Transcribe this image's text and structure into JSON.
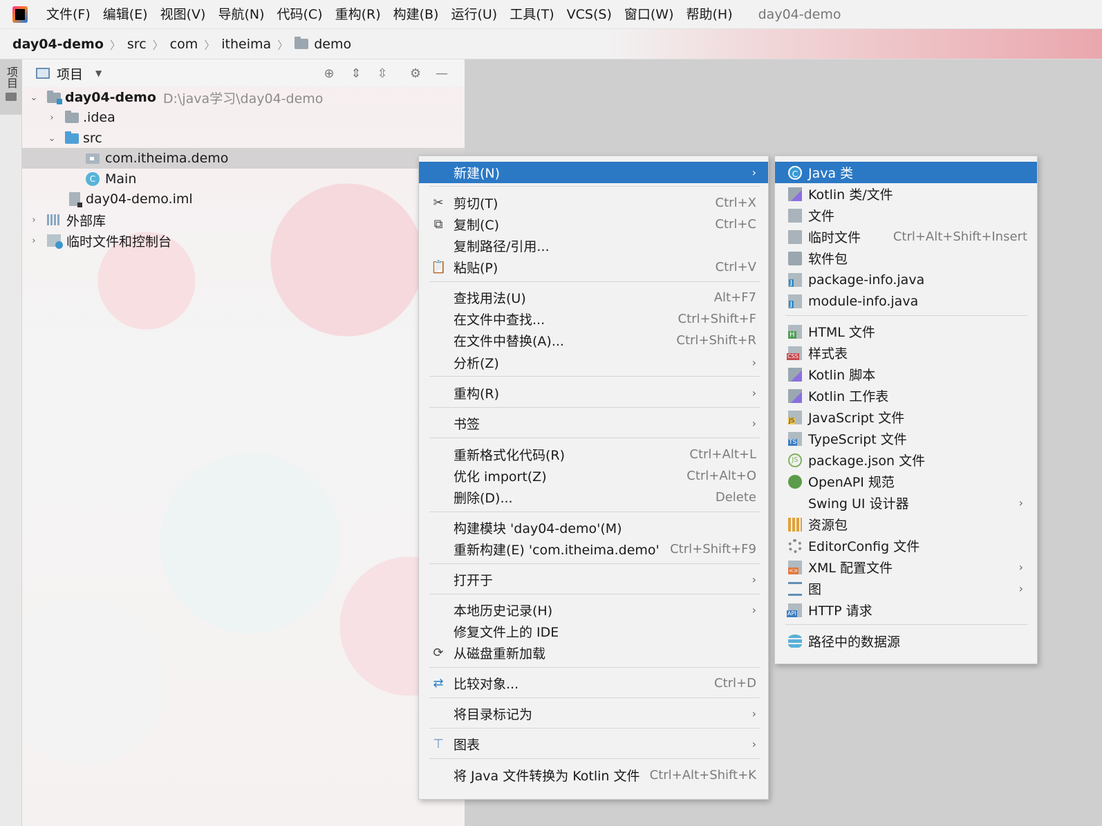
{
  "menubar": {
    "items": [
      "文件(F)",
      "编辑(E)",
      "视图(V)",
      "导航(N)",
      "代码(C)",
      "重构(R)",
      "构建(B)",
      "运行(U)",
      "工具(T)",
      "VCS(S)",
      "窗口(W)",
      "帮助(H)"
    ],
    "window_title": "day04-demo"
  },
  "breadcrumb": [
    "day04-demo",
    "src",
    "com",
    "itheima",
    "demo"
  ],
  "tool_stripe": {
    "label": "项目"
  },
  "project_panel": {
    "title": "项目",
    "tree": {
      "root_name": "day04-demo",
      "root_path": "D:\\java学习\\day04-demo",
      "idea": ".idea",
      "src": "src",
      "package": "com.itheima.demo",
      "main_class": "Main",
      "iml": "day04-demo.iml",
      "external_libs": "外部库",
      "scratches": "临时文件和控制台"
    }
  },
  "context_menu": {
    "new": "新建(N)",
    "cut": {
      "label": "剪切(T)",
      "shortcut": "Ctrl+X"
    },
    "copy": {
      "label": "复制(C)",
      "shortcut": "Ctrl+C"
    },
    "copy_path": "复制路径/引用...",
    "paste": {
      "label": "粘贴(P)",
      "shortcut": "Ctrl+V"
    },
    "find_usages": {
      "label": "查找用法(U)",
      "shortcut": "Alt+F7"
    },
    "find_in_files": {
      "label": "在文件中查找...",
      "shortcut": "Ctrl+Shift+F"
    },
    "replace_in_files": {
      "label": "在文件中替换(A)...",
      "shortcut": "Ctrl+Shift+R"
    },
    "analyze": "分析(Z)",
    "refactor": "重构(R)",
    "bookmarks": "书签",
    "reformat": {
      "label": "重新格式化代码(R)",
      "shortcut": "Ctrl+Alt+L"
    },
    "optimize_imports": {
      "label": "优化 import(Z)",
      "shortcut": "Ctrl+Alt+O"
    },
    "delete": {
      "label": "删除(D)...",
      "shortcut": "Delete"
    },
    "build_module": "构建模块 'day04-demo'(M)",
    "rebuild": {
      "label": "重新构建(E) 'com.itheima.demo'",
      "shortcut": "Ctrl+Shift+F9"
    },
    "open_in": "打开于",
    "local_history": "本地历史记录(H)",
    "repair_ide": "修复文件上的 IDE",
    "reload_from_disk": "从磁盘重新加载",
    "compare_with": {
      "label": "比较对象...",
      "shortcut": "Ctrl+D"
    },
    "mark_directory": "将目录标记为",
    "diagrams": "图表",
    "convert_kotlin": {
      "label": "将 Java 文件转换为 Kotlin 文件",
      "shortcut": "Ctrl+Alt+Shift+K"
    }
  },
  "submenu": {
    "java_class": "Java 类",
    "kotlin_class": "Kotlin 类/文件",
    "file": "文件",
    "scratch": {
      "label": "临时文件",
      "shortcut": "Ctrl+Alt+Shift+Insert"
    },
    "package": "软件包",
    "package_info": "package-info.java",
    "module_info": "module-info.java",
    "html": "HTML 文件",
    "stylesheet": "样式表",
    "kotlin_script": "Kotlin 脚本",
    "kotlin_worksheet": "Kotlin 工作表",
    "javascript": "JavaScript 文件",
    "typescript": "TypeScript 文件",
    "package_json": "package.json 文件",
    "openapi": "OpenAPI 规范",
    "swing": "Swing UI 设计器",
    "resource_bundle": "资源包",
    "editorconfig": "EditorConfig 文件",
    "xml_config": "XML 配置文件",
    "diagram": "图",
    "http_request": "HTTP 请求",
    "data_source": "路径中的数据源"
  },
  "colors": {
    "selection": "#2b78c5",
    "menu_bg": "#f2f2f2"
  }
}
